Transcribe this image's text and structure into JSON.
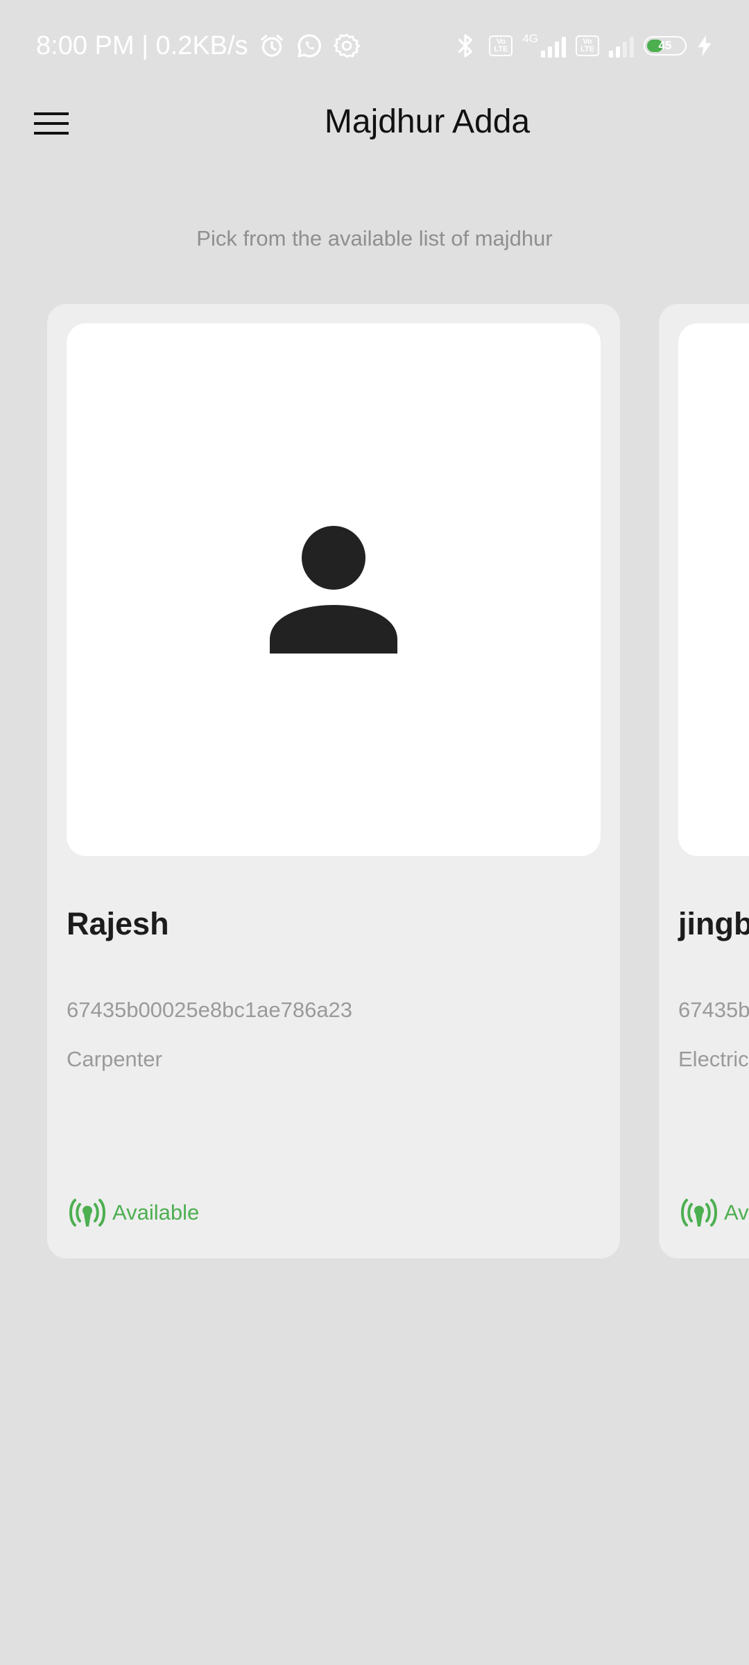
{
  "status_bar": {
    "time": "8:00 PM | 0.2KB/s",
    "network_type": "4G",
    "volte_label": "Vo LTE",
    "battery_level": "45",
    "battery_fraction": 0.45,
    "icons": [
      "alarm-icon",
      "whatsapp-icon",
      "settings-icon",
      "bluetooth-icon",
      "volte-icon",
      "signal-icon",
      "battery-icon",
      "charging-icon"
    ]
  },
  "app_bar": {
    "title": "Majdhur Adda",
    "menu_icon": "hamburger-menu-icon"
  },
  "subtitle": "Pick from the available list of majdhur",
  "workers": [
    {
      "name": "Rajesh",
      "id": "67435b00025e8bc1ae786a23",
      "role": "Carpenter",
      "status": "Available"
    },
    {
      "name": "jingb",
      "id": "67435b",
      "role": "Electric",
      "status": "Av"
    }
  ],
  "colors": {
    "background": "#e0e0e0",
    "card": "#eeeeee",
    "available": "#4caf50",
    "muted_text": "#9a9a9a"
  }
}
